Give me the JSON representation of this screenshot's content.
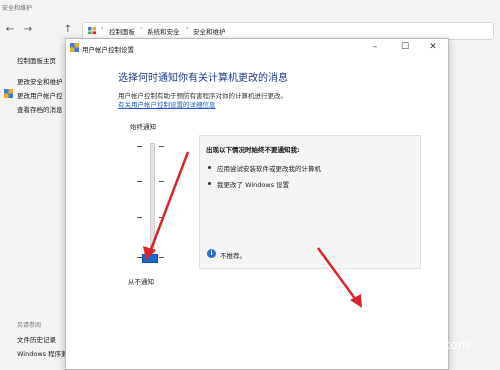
{
  "background_window": {
    "title": "安全和维护",
    "nav": {
      "back": "←",
      "forward": "→",
      "up": "↑"
    },
    "breadcrumb": [
      "控制面板",
      "系统和安全",
      "安全和维护"
    ],
    "left_links": [
      "控制面板主页",
      "更改安全和维护",
      "更改用户帐户控",
      "查看存档的消息"
    ],
    "see_also": "另请参阅",
    "bottom_links": [
      "文件历史记录",
      "Windows 程序兼"
    ]
  },
  "dialog": {
    "title": "用户帐户控制设置",
    "window_controls": {
      "minimize": "–",
      "maximize": "☐",
      "close": "✕"
    },
    "heading": "选择何时通知你有关计算机更改的消息",
    "description": "用户帐户控制有助于预防有害程序对你的计算机进行更改。",
    "link": "有关用户帐户控制设置的详细信息",
    "slider": {
      "top_label": "始终通知",
      "bottom_label": "从不通知",
      "levels": 4,
      "value": 0
    },
    "panel": {
      "title": "出现以下情况时始终不要通知我:",
      "bullets": [
        "应用尝试安装软件或更改我的计算机",
        "我更改了 Windows 设置"
      ],
      "info": "不推荐。"
    }
  },
  "watermark": {
    "cn": "爱纯净",
    "en": "aichunjing.com"
  },
  "colors": {
    "accent": "#1e66c8",
    "heading": "#1e3b8a",
    "link": "#1f5fbf",
    "arrow": "#d9262c"
  }
}
